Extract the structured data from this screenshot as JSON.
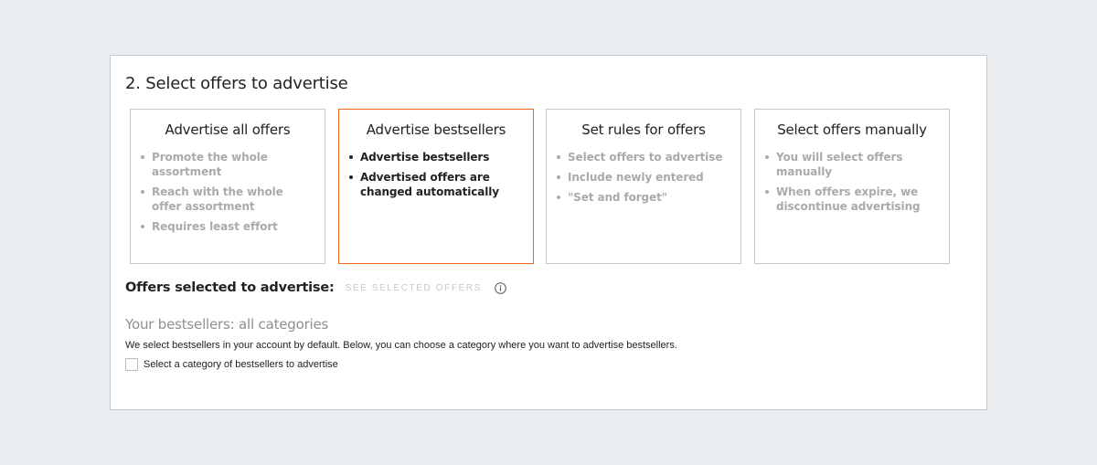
{
  "section": {
    "title": "2. Select offers to advertise"
  },
  "cards": [
    {
      "title": "Advertise all offers",
      "bullets": [
        "Promote the whole assortment",
        "Reach with the whole offer assortment",
        "Requires least effort"
      ]
    },
    {
      "title": "Advertise bestsellers",
      "bullets": [
        "Advertise bestsellers",
        "Advertised offers are changed automatically"
      ]
    },
    {
      "title": "Set rules for offers",
      "bullets": [
        "Select offers to advertise",
        "Include newly entered",
        "\"Set and forget\""
      ]
    },
    {
      "title": "Select offers manually",
      "bullets": [
        "You will select offers manually",
        "When offers expire, we discontinue advertising"
      ]
    }
  ],
  "selected_card_index": 1,
  "offers": {
    "label": "Offers selected to advertise:",
    "link": "SEE SELECTED OFFERS",
    "info_icon": "info-circle-icon"
  },
  "bestsellers": {
    "title": "Your bestsellers: all categories",
    "description": "We select bestsellers in your account by default. Below, you can choose a category where you want to advertise bestsellers.",
    "checkbox_label": "Select a category of bestsellers to advertise",
    "checkbox_checked": false
  },
  "colors": {
    "accent": "#f06a1e",
    "background": "#ebeef1",
    "border": "#c5c9cd",
    "muted_text": "#aaaaaa"
  }
}
